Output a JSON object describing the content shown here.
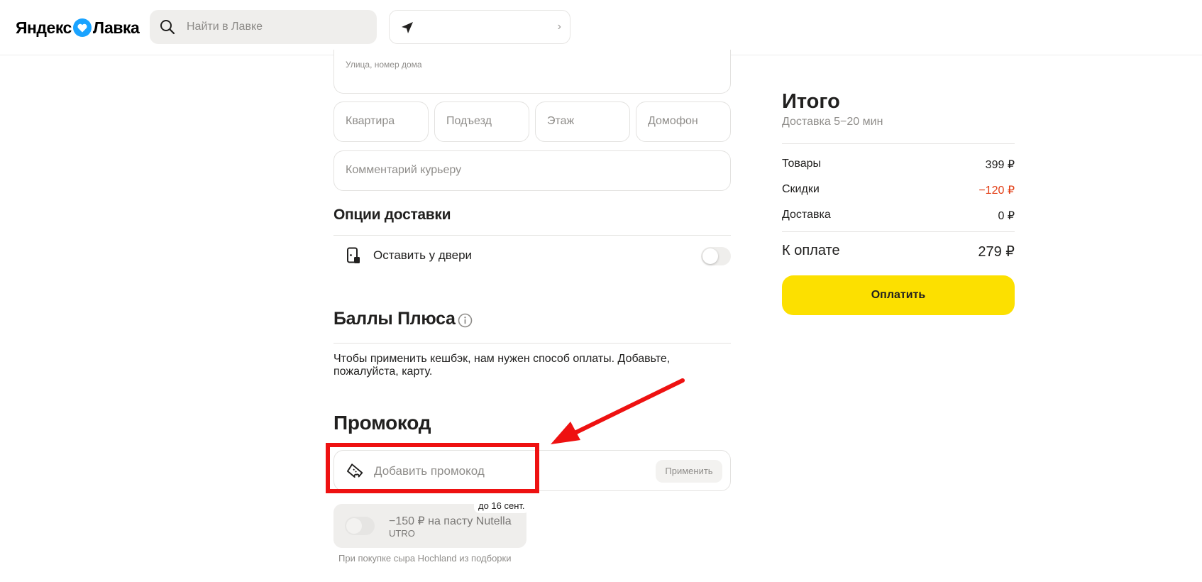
{
  "header": {
    "logo_left": "Яндекс",
    "logo_right": "Лавка",
    "search_placeholder": "Найти в Лавке",
    "address_chevron": "›"
  },
  "address_form": {
    "street_label": "Улица, номер дома",
    "apartment": "Квартира",
    "entrance": "Подъезд",
    "floor": "Этаж",
    "intercom": "Домофон",
    "courier_comment": "Комментарий курьеру"
  },
  "delivery_options": {
    "title": "Опции доставки",
    "leave_at_door": "Оставить у двери",
    "leave_at_door_enabled": false
  },
  "plus_points": {
    "title": "Баллы Плюса",
    "message": "Чтобы применить кешбэк, нам нужен способ оплаты. Добавьте, пожалуйста, карту."
  },
  "promo": {
    "title": "Промокод",
    "placeholder": "Добавить промокод",
    "apply_label": "Применить",
    "coupon": {
      "deadline": "до 16 сент.",
      "title": "−150 ₽ на пасту Nutella",
      "code": "UTRO",
      "note": "При покупке сыра Hochland из подборки",
      "enabled": false
    }
  },
  "summary": {
    "title": "Итого",
    "delivery_time": "Доставка 5−20 мин",
    "rows": [
      {
        "label": "Товары",
        "value": "399 ₽"
      },
      {
        "label": "Скидки",
        "value": "−120 ₽"
      },
      {
        "label": "Доставка",
        "value": "0 ₽"
      }
    ],
    "to_pay_label": "К оплате",
    "to_pay_value": "279 ₽",
    "pay_button": "Оплатить"
  },
  "colors": {
    "accent_yellow": "#fce000",
    "discount_red": "#e23d14",
    "annotation_red": "#ee1111",
    "logo_heart": "#1aa3ff"
  },
  "icons": [
    "search-icon",
    "navigation-arrow-icon",
    "chevron-right-icon",
    "door-phone-icon",
    "info-icon",
    "ticket-icon",
    "heart-logo-icon"
  ]
}
